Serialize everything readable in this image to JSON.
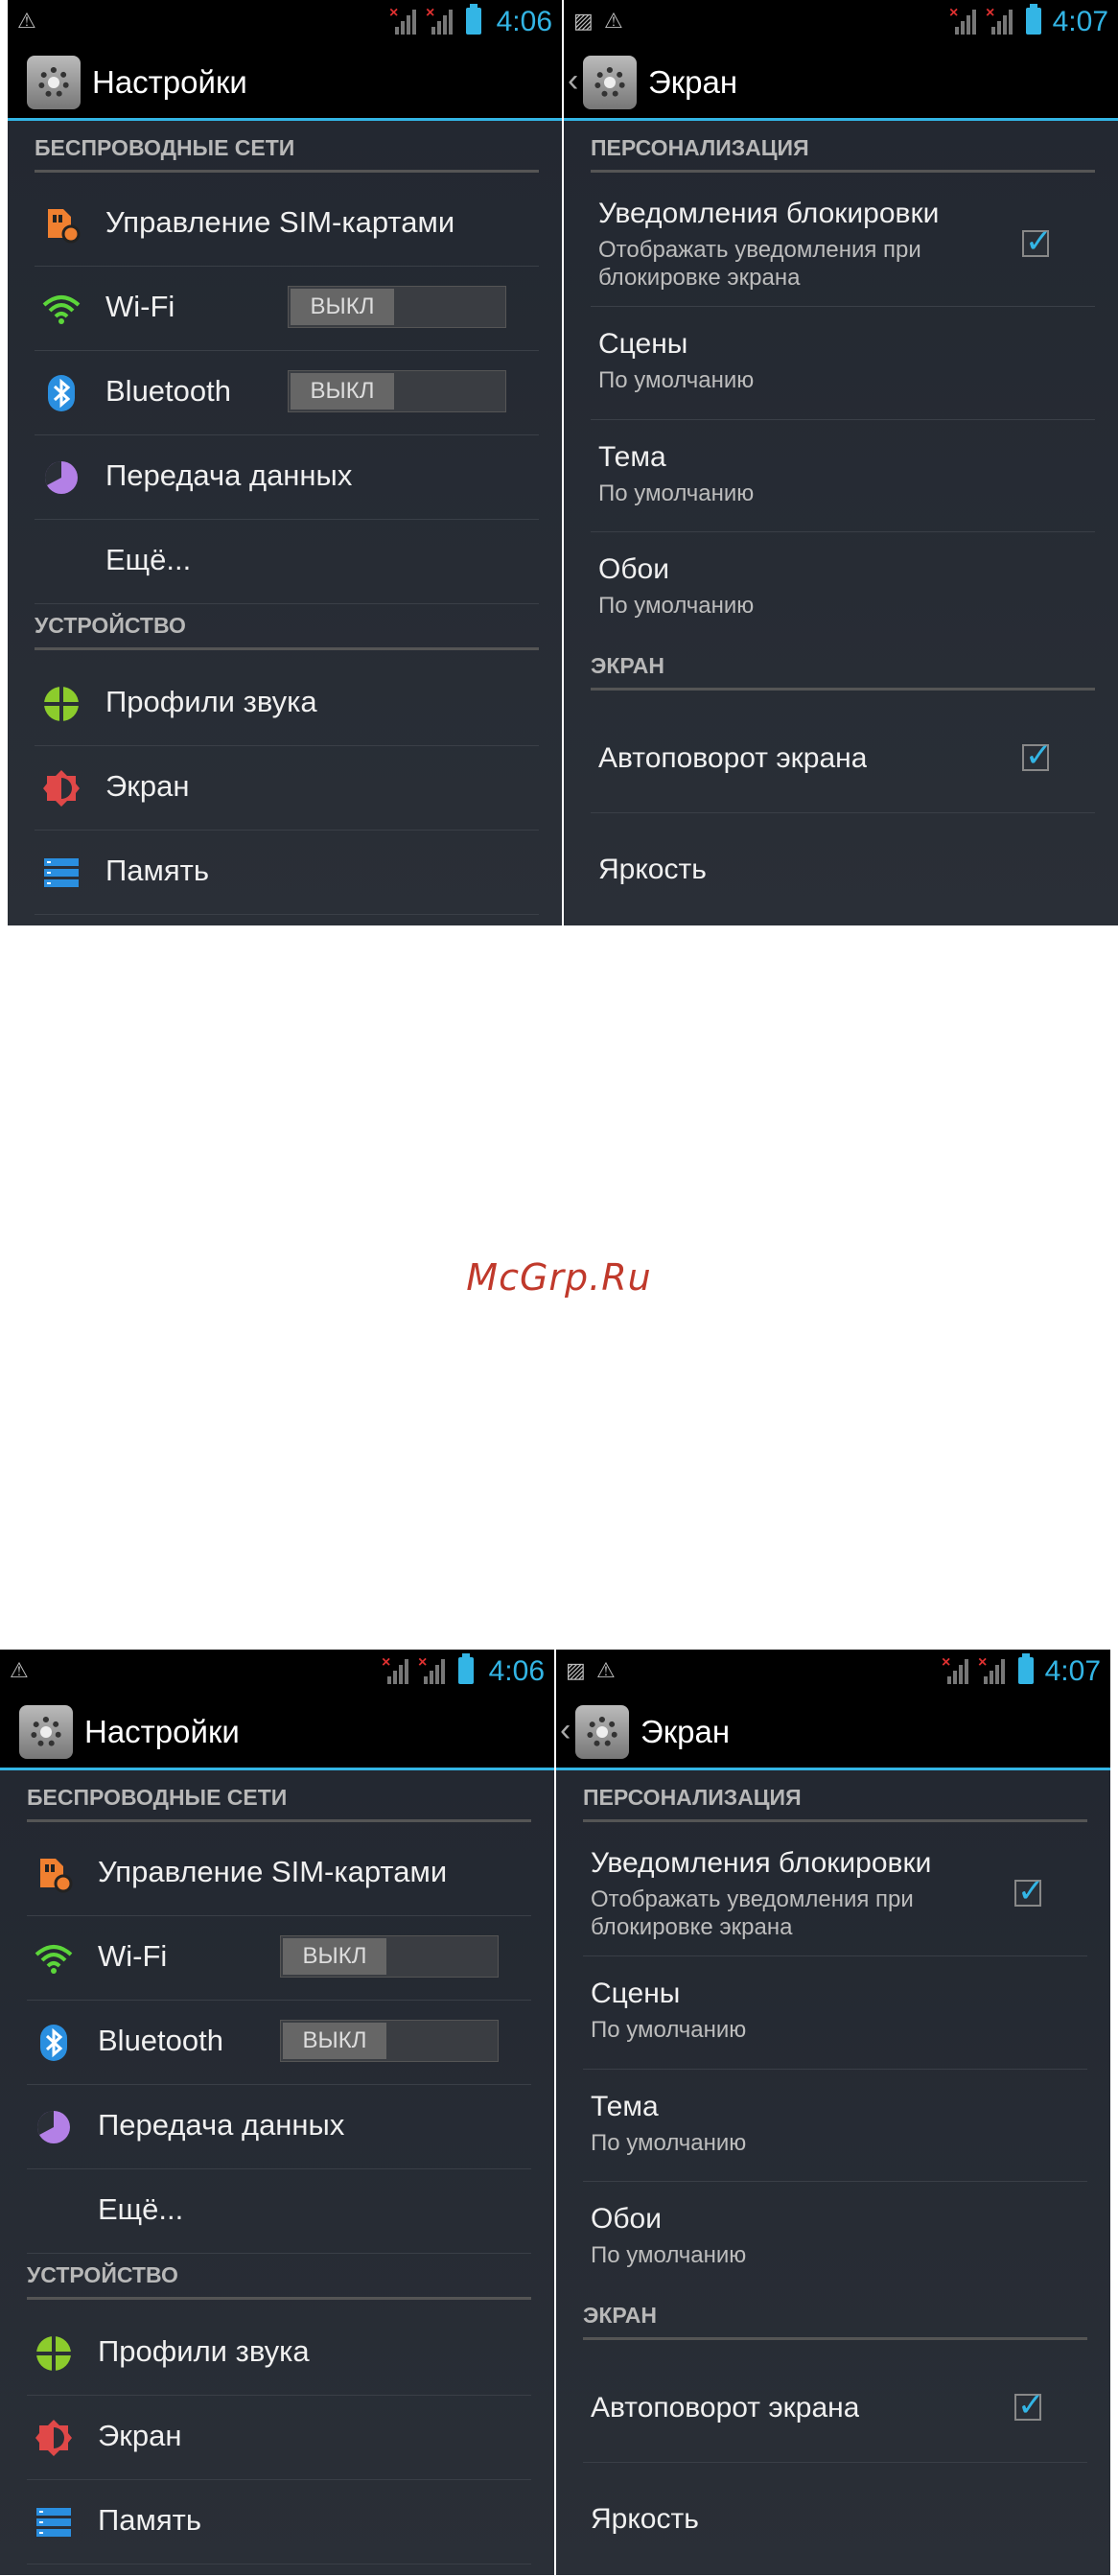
{
  "watermark": "McGrp.Ru",
  "colors": {
    "accent": "#33b5e5",
    "background": "#222730",
    "statusbar": "#000000",
    "watermark": "#c0392b"
  },
  "left": {
    "status": {
      "time": "4:06",
      "icons": [
        "warning-icon",
        "signal-no-sim-icon",
        "signal-no-sim-icon",
        "battery-icon"
      ]
    },
    "title": "Настройки",
    "sections": [
      {
        "header": "БЕСПРОВОДНЫЕ СЕТИ",
        "items": [
          {
            "label": "Управление SIM-картами",
            "icon": "sim-card-settings-icon"
          },
          {
            "label": "Wi-Fi",
            "icon": "wifi-icon",
            "toggle": "ВЫКЛ"
          },
          {
            "label": "Bluetooth",
            "icon": "bluetooth-icon",
            "toggle": "ВЫКЛ"
          },
          {
            "label": "Передача данных",
            "icon": "data-usage-icon"
          },
          {
            "label": "Ещё..."
          }
        ]
      },
      {
        "header": "УСТРОЙСТВО",
        "items": [
          {
            "label": "Профили звука",
            "icon": "sound-profile-icon"
          },
          {
            "label": "Экран",
            "icon": "display-icon"
          },
          {
            "label": "Память",
            "icon": "storage-icon"
          }
        ]
      }
    ]
  },
  "right": {
    "status": {
      "time": "4:07",
      "icons": [
        "image-icon",
        "warning-icon",
        "signal-no-sim-icon",
        "signal-no-sim-icon",
        "battery-icon"
      ]
    },
    "title": "Экран",
    "sections": [
      {
        "header": "ПЕРСОНАЛИЗАЦИЯ",
        "items": [
          {
            "title": "Уведомления блокировки",
            "subtitle": "Отображать уведомления при блокировке экрана",
            "checked": true
          },
          {
            "title": "Сцены",
            "subtitle": "По умолчанию"
          },
          {
            "title": "Тема",
            "subtitle": "По умолчанию"
          },
          {
            "title": "Обои",
            "subtitle": "По умолчанию"
          }
        ]
      },
      {
        "header": "ЭКРАН",
        "items": [
          {
            "title": "Автоповорот экрана",
            "checked": true
          },
          {
            "title": "Яркость"
          }
        ]
      }
    ]
  }
}
